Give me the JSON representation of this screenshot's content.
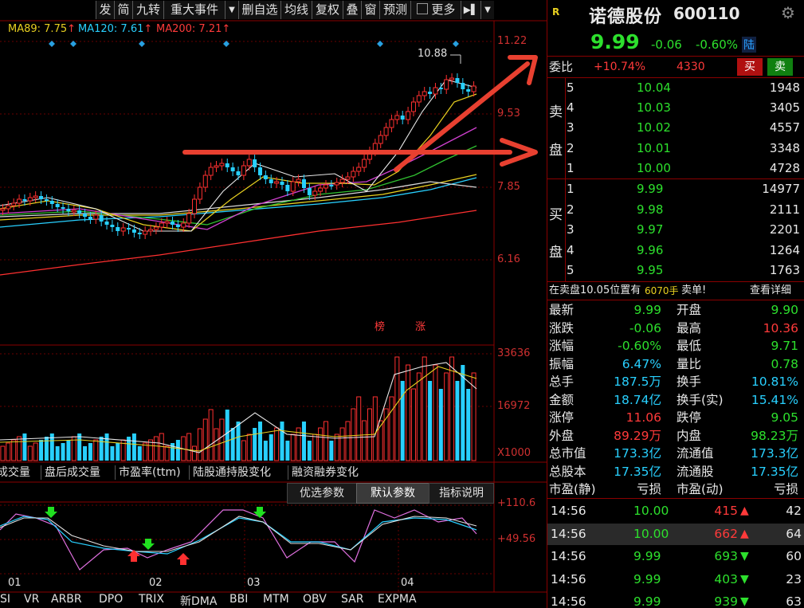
{
  "toolbar": {
    "buttons": [
      "发",
      "简",
      "九转",
      "重大事件",
      "▼",
      "删自选",
      "均线",
      "复权",
      "叠",
      "窗",
      "预测",
      "更多",
      "▶▌",
      "▼"
    ]
  },
  "ma_legend": [
    {
      "label": "MA89: 7.75",
      "arrow": "↑",
      "color": "#e8d020"
    },
    {
      "label": "MA120: 7.61",
      "arrow": "↑",
      "color": "#28d0ff"
    },
    {
      "label": "MA200: 7.21",
      "arrow": "↑",
      "color": "#ff3a3a"
    }
  ],
  "main_chart": {
    "y_labels": [
      "11.22",
      "9.53",
      "7.85",
      "6.16"
    ],
    "high_marker": "10.88",
    "tags": [
      "榜",
      "涨"
    ]
  },
  "volume_chart": {
    "y_labels": [
      "33636",
      "16972",
      "X1000"
    ]
  },
  "indicator_tabs": [
    "成交量",
    "盘后成交量",
    "市盈率(ttm)",
    "陆股通持股变化",
    "融资融券变化"
  ],
  "param_tabs": [
    "优选参数",
    "默认参数",
    "指标说明"
  ],
  "oscillator": {
    "y_labels": [
      "+110.6",
      "+49.56"
    ],
    "x_labels": [
      "01",
      "02",
      "03",
      "04"
    ]
  },
  "bottom_tabs": [
    "SI",
    "VR",
    "ARBR",
    "DPO",
    "TRIX",
    "新DMA",
    "BBI",
    "MTM",
    "OBV",
    "SAR",
    "EXPMA"
  ],
  "stock": {
    "logo": "R",
    "name": "诺德股份",
    "code": "600110",
    "price": "9.99",
    "change": "-0.06",
    "change_pct": "-0.60%",
    "market": "陆"
  },
  "weibi": {
    "label": "委比",
    "pct": "+10.74%",
    "diff": "4330",
    "buy": "买",
    "sell": "卖"
  },
  "sell_label": [
    "卖",
    "盘"
  ],
  "buy_label": [
    "买",
    "盘"
  ],
  "asks": [
    {
      "lv": "5",
      "price": "10.04",
      "vol": "1948"
    },
    {
      "lv": "4",
      "price": "10.03",
      "vol": "3405"
    },
    {
      "lv": "3",
      "price": "10.02",
      "vol": "4557"
    },
    {
      "lv": "2",
      "price": "10.01",
      "vol": "3348"
    },
    {
      "lv": "1",
      "price": "10.00",
      "vol": "4728"
    }
  ],
  "bids": [
    {
      "lv": "1",
      "price": "9.99",
      "vol": "14977"
    },
    {
      "lv": "2",
      "price": "9.98",
      "vol": "2111"
    },
    {
      "lv": "3",
      "price": "9.97",
      "vol": "2201"
    },
    {
      "lv": "4",
      "price": "9.96",
      "vol": "1264"
    },
    {
      "lv": "5",
      "price": "9.95",
      "vol": "1763"
    }
  ],
  "alert": {
    "text1": "在卖盘10.05位置有",
    "text2": "6070手",
    "text3": "卖单!",
    "link": "查看详细"
  },
  "stats": [
    {
      "l1": "最新",
      "v1": "9.99",
      "c1": "g",
      "l2": "开盘",
      "v2": "9.90",
      "c2": "g"
    },
    {
      "l1": "涨跌",
      "v1": "-0.06",
      "c1": "g",
      "l2": "最高",
      "v2": "10.36",
      "c2": "r"
    },
    {
      "l1": "涨幅",
      "v1": "-0.60%",
      "c1": "g",
      "l2": "最低",
      "v2": "9.71",
      "c2": "g"
    },
    {
      "l1": "振幅",
      "v1": "6.47%",
      "c1": "c",
      "l2": "量比",
      "v2": "0.78",
      "c2": "g"
    },
    {
      "l1": "总手",
      "v1": "187.5万",
      "c1": "c",
      "l2": "换手",
      "v2": "10.81%",
      "c2": "c"
    },
    {
      "l1": "金额",
      "v1": "18.74亿",
      "c1": "c",
      "l2": "换手(实)",
      "v2": "15.41%",
      "c2": "c"
    },
    {
      "l1": "涨停",
      "v1": "11.06",
      "c1": "r",
      "l2": "跌停",
      "v2": "9.05",
      "c2": "g"
    },
    {
      "l1": "外盘",
      "v1": "89.29万",
      "c1": "r",
      "l2": "内盘",
      "v2": "98.23万",
      "c2": "g"
    },
    {
      "l1": "总市值",
      "v1": "173.3亿",
      "c1": "c",
      "l2": "流通值",
      "v2": "173.3亿",
      "c2": "c"
    },
    {
      "l1": "总股本",
      "v1": "17.35亿",
      "c1": "c",
      "l2": "流通股",
      "v2": "17.35亿",
      "c2": "c"
    },
    {
      "l1": "市盈(静)",
      "v1": "亏损",
      "c1": "w",
      "l2": "市盈(动)",
      "v2": "亏损",
      "c2": "w"
    }
  ],
  "ticks": [
    {
      "time": "14:56",
      "price": "10.00",
      "vol": "415",
      "dir": "up",
      "num": "42"
    },
    {
      "time": "14:56",
      "price": "10.00",
      "vol": "662",
      "dir": "up",
      "num": "64"
    },
    {
      "time": "14:56",
      "price": "9.99",
      "vol": "693",
      "dir": "down",
      "num": "60"
    },
    {
      "time": "14:56",
      "price": "9.99",
      "vol": "403",
      "dir": "down",
      "num": "23"
    },
    {
      "time": "14:56",
      "price": "9.99",
      "vol": "939",
      "dir": "down",
      "num": "63"
    }
  ]
}
